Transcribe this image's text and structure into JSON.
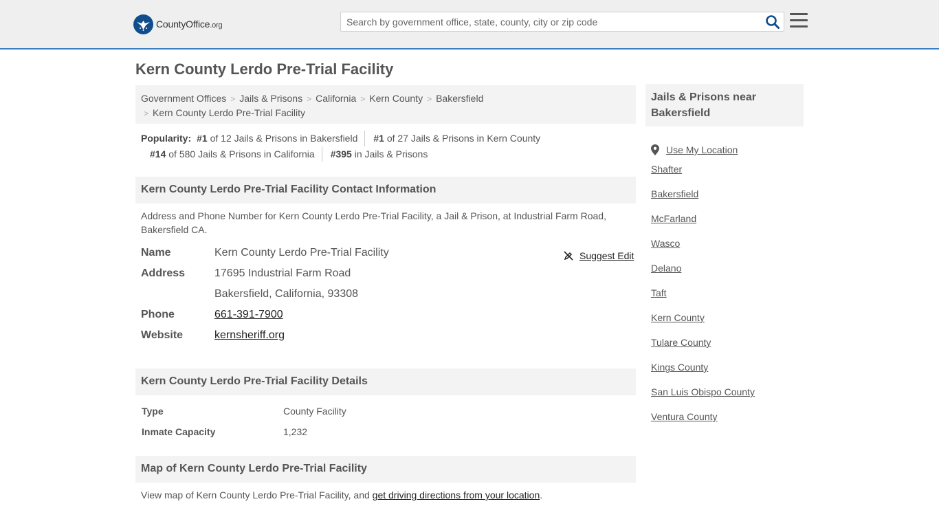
{
  "header": {
    "logo_text_main": "CountyOffice",
    "logo_text_tld": ".org",
    "search_placeholder": "Search by government office, state, county, city or zip code"
  },
  "page": {
    "title": "Kern County Lerdo Pre-Trial Facility"
  },
  "breadcrumb": {
    "items": [
      "Government Offices",
      "Jails & Prisons",
      "California",
      "Kern County",
      "Bakersfield"
    ],
    "current": "Kern County Lerdo Pre-Trial Facility"
  },
  "popularity": {
    "label": "Popularity:",
    "items": [
      {
        "rank": "#1",
        "text": "of 12 Jails & Prisons in Bakersfield"
      },
      {
        "rank": "#1",
        "text": "of 27 Jails & Prisons in Kern County"
      },
      {
        "rank": "#14",
        "text": "of 580 Jails & Prisons in California"
      },
      {
        "rank": "#395",
        "text": "in Jails & Prisons"
      }
    ]
  },
  "contact": {
    "heading": "Kern County Lerdo Pre-Trial Facility Contact Information",
    "description": "Address and Phone Number for Kern County Lerdo Pre-Trial Facility, a Jail & Prison, at Industrial Farm Road, Bakersfield CA.",
    "suggest_edit": "Suggest Edit",
    "name_label": "Name",
    "name_value": "Kern County Lerdo Pre-Trial Facility",
    "address_label": "Address",
    "address_line1": "17695 Industrial Farm Road",
    "address_line2": "Bakersfield, California, 93308",
    "phone_label": "Phone",
    "phone_value": "661-391-7900",
    "website_label": "Website",
    "website_value": "kernsheriff.org"
  },
  "details": {
    "heading": "Kern County Lerdo Pre-Trial Facility Details",
    "type_label": "Type",
    "type_value": "County Facility",
    "capacity_label": "Inmate Capacity",
    "capacity_value": "1,232"
  },
  "map": {
    "heading": "Map of Kern County Lerdo Pre-Trial Facility",
    "text_before": "View map of Kern County Lerdo Pre-Trial Facility, and ",
    "link_text": "get driving directions from your location",
    "text_after": "."
  },
  "sidebar": {
    "heading": "Jails & Prisons near Bakersfield",
    "use_location": "Use My Location",
    "links": [
      "Shafter",
      "Bakersfield",
      "McFarland",
      "Wasco",
      "Delano",
      "Taft",
      "Kern County",
      "Tulare County",
      "Kings County",
      "San Luis Obispo County",
      "Ventura County"
    ]
  },
  "colors": {
    "brand_blue": "#0f4d8c",
    "header_border": "#3a7fc2",
    "section_bg": "#f3f3f3"
  }
}
